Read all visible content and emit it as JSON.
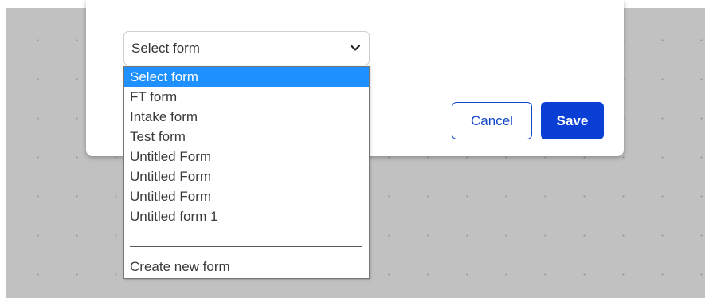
{
  "form_selector": {
    "selected_value": "Select form",
    "options": [
      "Select form",
      "FT form",
      "Intake form",
      "Test form",
      "Untitled Form",
      "Untitled Form",
      "Untitled Form",
      "Untitled form 1"
    ],
    "create_new_label": "Create new form"
  },
  "actions": {
    "cancel_label": "Cancel",
    "save_label": "Save"
  },
  "icons": {
    "select_chevron": "chevron-down-icon"
  },
  "colors": {
    "primary": "#0a3fd6",
    "highlight": "#1e90ff",
    "canvas": "#c1c1c1"
  }
}
